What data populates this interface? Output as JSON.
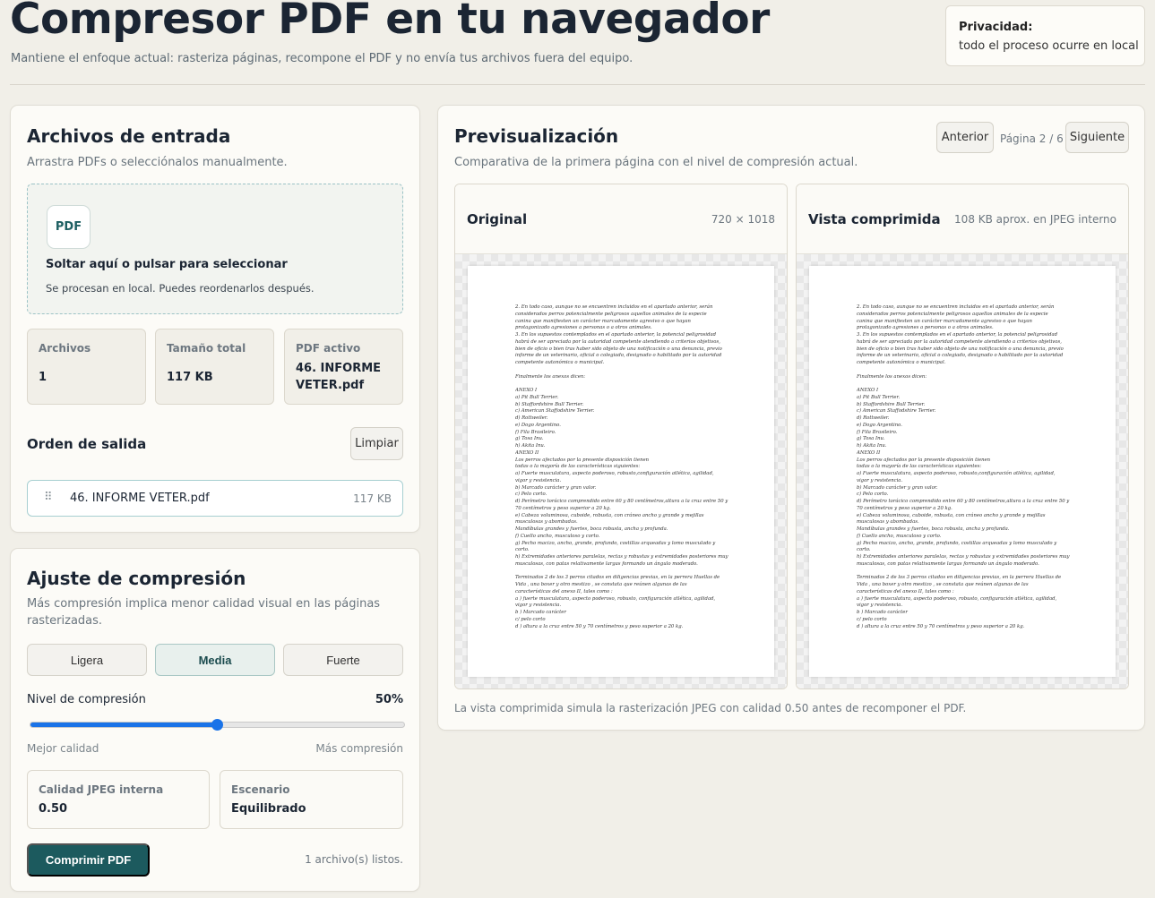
{
  "header": {
    "title": "Compresor PDF en tu navegador",
    "subtitle": "Mantiene el enfoque actual: rasteriza páginas, recompone el PDF y no envía tus archivos fuera del equipo.",
    "privacy_label": "Privacidad:",
    "privacy_text": "todo el proceso ocurre en local"
  },
  "input_panel": {
    "title": "Archivos de entrada",
    "description": "Arrastra PDFs o selecciónalos manualmente.",
    "dropzone": {
      "badge": "PDF",
      "title": "Soltar aquí o pulsar para seleccionar",
      "subtitle": "Se procesan en local. Puedes reordenarlos después."
    },
    "stats": [
      {
        "label": "Archivos",
        "value": "1"
      },
      {
        "label": "Tamaño total",
        "value": "117 KB"
      },
      {
        "label": "PDF activo",
        "value": "46. INFORME VETER.pdf"
      }
    ],
    "output_order_label": "Orden de salida",
    "clear_label": "Limpiar",
    "files": [
      {
        "handle": "⠿",
        "name": "46. INFORME VETER.pdf",
        "size": "117 KB"
      }
    ]
  },
  "compression_panel": {
    "title": "Ajuste de compresión",
    "description": "Más compresión implica menor calidad visual en las páginas rasterizadas.",
    "presets": [
      "Ligera",
      "Media",
      "Fuerte"
    ],
    "active_preset": "Media",
    "slider_label": "Nivel de compresión",
    "slider_value": "50%",
    "slider_fraction": 0.5,
    "slider_min_label": "Mejor calidad",
    "slider_max_label": "Más compresión",
    "jpeg_quality_label": "Calidad JPEG interna",
    "jpeg_quality_value": "0.50",
    "scenario_label": "Escenario",
    "scenario_value": "Equilibrado",
    "compress_label": "Comprimir PDF",
    "status": "1 archivo(s) listos."
  },
  "preview_panel": {
    "title": "Previsualización",
    "description": "Comparativa de la primera página con el nivel de compresión actual.",
    "prev_label": "Anterior",
    "page_label": "Página 2 / 6",
    "next_label": "Siguiente",
    "original_title": "Original",
    "original_meta": "720 × 1018",
    "compressed_title": "Vista comprimida",
    "compressed_meta": "108 KB aprox. en JPEG interno",
    "note": "La vista comprimida simula la rasterización JPEG con calidad 0.50 antes de recomponer el PDF."
  },
  "document_lines": [
    "2. En todo caso, aunque no se encuentren incluidos en el apartado anterior, serán",
    "considerados perros potencialmente peligrosos aquellos animales de la especie",
    "canina que manifiesten un carácter marcadamente agresivo o que hayan",
    "protagonizado agresiones a personas o a otros animales.",
    "3. En los supuestos contemplados en el apartado anterior, la potencial peligrosidad",
    "habrá de ser apreciada por la autoridad competente atendiendo a criterios objetivos,",
    "bien de oficio o bien tras haber sido objeto de una notificación o una denuncia, previo",
    "informe de un veterinario, oficial o colegiado, designado o habilitado por la autoridad",
    "competente autonómica o municipal.",
    "",
    "Finalmente los anexos dicen:",
    "",
    "ANEXO I",
    "a) Pit Bull Terrier.",
    "b) Staffordshire Bull Terrier.",
    "c) American Staffodshire Terrier.",
    "d) Rottweiler.",
    "e) Dogo Argentino.",
    "f) Fila Brasileiro.",
    "g) Tosa Inu.",
    "h) Akita Inu.",
    "ANEXO II",
    "Los perros afectados por la presente disposición tienen",
    "todas o la mayoría de las características siguientes:",
    "a) Fuerte musculatura, aspecto poderoso, robusto,configuración atlética, agilidad,",
    "vigor y resistencia.",
    "b) Marcado carácter y gran valor.",
    "c) Pelo corto.",
    "d) Perímetro torácico comprendido entre 60 y 80 centímetros,altura a la cruz entre 50 y",
    "70 centímetros y peso superior a 20 kg.",
    "e) Cabeza voluminosa, cuboide, robusta, con cráneo ancho y grande y mejillas",
    "musculosas y abombadas.",
    "Mandíbulas grandes y fuertes, boca robusta, ancha y profunda.",
    "f) Cuello ancho, musculoso y corto.",
    "g) Pecho macizo, ancho, grande, profundo, costillas arqueadas y lomo musculado y",
    "corto.",
    "h) Extremidades anteriores paralelas, rectas y robustas y extremidades posteriores muy",
    "musculosas, con patas relativamente largas formando un ángulo moderado.",
    "",
    "Terminados 2 de los 3 perros citados en diligencias previas,   en la perrera Huellas de",
    "Vida , una  boxer y otro mestizo ,  se constata que reúnen algunas de las",
    "características del anexo II, tales como :",
    "a ) fuerte musculatura, aspecto poderoso, robusto, configuración atlética, agilidad,",
    "vigor y resistencia.",
    "b ) Marcado carácter",
    "c/ pelo corto",
    "d ) altura a la cruz entre 50 y 70 centímetros y peso superior a 20 kg."
  ]
}
